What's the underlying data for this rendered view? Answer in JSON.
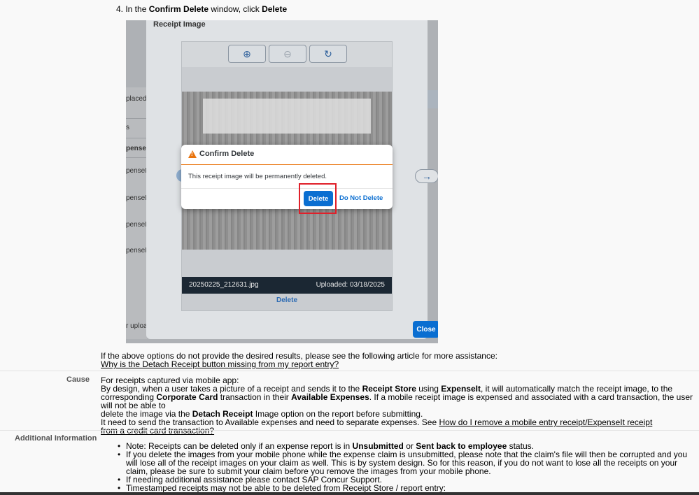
{
  "step": {
    "prefix": "4. In the ",
    "window": "Confirm Delete",
    "middle": " window, click ",
    "action": "Delete"
  },
  "screenshot": {
    "background_rows": [
      "placed",
      "s",
      "pense",
      "penseIt",
      "penseIt",
      "penseIt",
      "penseIt",
      "r uploa"
    ],
    "modal_title": "Receipt Image",
    "viewer": {
      "tools": [
        {
          "icon": "zoom-in-icon",
          "glyph": "⊕"
        },
        {
          "icon": "zoom-out-icon",
          "glyph": "⊖"
        },
        {
          "icon": "rotate-icon",
          "glyph": "↻"
        }
      ],
      "filename": "20250225_212631.jpg",
      "uploaded": "Uploaded: 03/18/2025",
      "delete_label": "Delete"
    },
    "nav_left": "←",
    "nav_right": "→",
    "close_label": "Close",
    "dialog": {
      "title": "Confirm Delete",
      "message": "This receipt image will be permanently deleted.",
      "delete_label": "Delete",
      "cancel_label": "Do Not Delete"
    },
    "colors": {
      "accent": "#0a6ed1",
      "warning": "#e9730c",
      "highlight": "#e0202a"
    }
  },
  "after": {
    "text": "If the above options do not provide the desired results, please see the following article for more assistance:",
    "link": "Why is the Detach Receipt button missing from my report entry?"
  },
  "cause": {
    "label": "Cause",
    "line1": "For receipts captured via mobile app:",
    "line2_a": "By design, when a user takes a picture of a receipt and sends it to the ",
    "line2_b": "Receipt Store",
    "line2_c": " using ",
    "line2_d": "ExpenseIt",
    "line2_e": ", it will automatically match the receipt image, to the",
    "line3_a": "corresponding ",
    "line3_b": "Corporate Card",
    "line3_c": " transaction in their ",
    "line3_d": "Available Expenses",
    "line3_e": ". If a mobile receipt image is expensed and associated with a card transaction, the user will not be able to",
    "line4_a": "delete the image via the ",
    "line4_b": "Detach Receipt",
    "line4_c": " Image option on the report before submitting.",
    "line5": "It need to send the transaction to Available expenses and need to separate expenses.  See ",
    "link": "How do I remove a mobile entry receipt/ExpenseIt receipt from a credit card transaction?"
  },
  "additional": {
    "label": "Additional Information",
    "b1_a": "Note: Receipts can be deleted only if an expense report is in ",
    "b1_b": "Unsubmitted",
    "b1_c": " or ",
    "b1_d": "Sent back to employee",
    "b1_e": " status.",
    "b2": "If you delete the images from your mobile phone while the expense claim is unsubmitted, please note that the claim's file will then be corrupted and you will lose all of the receipt images on your claim as well. This is by system design. So for this reason, if you do not want to lose all the receipts on your claim, please be sure to submit your claim before you remove the images from your mobile phone.",
    "b3": "If needing additional assistance please contact SAP Concur Support.",
    "b4": "Timestamped receipts may not be able to be deleted from Receipt Store / report entry:"
  }
}
